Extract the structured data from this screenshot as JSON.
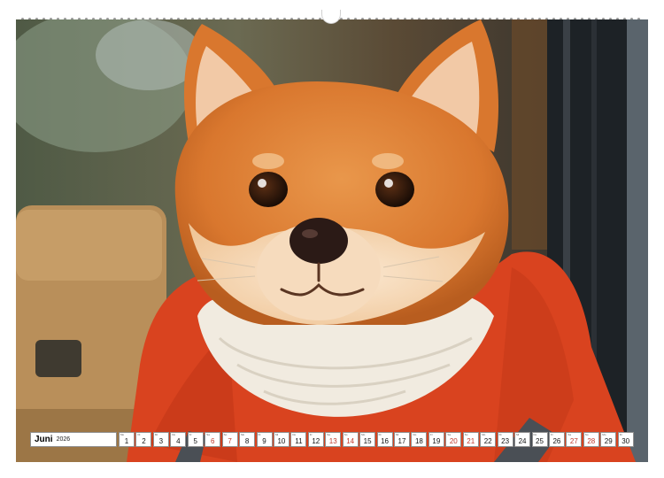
{
  "calendar": {
    "month": "Juni",
    "year": "2026",
    "weekend_color": "#c0392b",
    "days": [
      {
        "num": "1",
        "abbr": "Mo",
        "weekend": false
      },
      {
        "num": "2",
        "abbr": "Di",
        "weekend": false
      },
      {
        "num": "3",
        "abbr": "Mi",
        "weekend": false
      },
      {
        "num": "4",
        "abbr": "Do",
        "weekend": false
      },
      {
        "num": "5",
        "abbr": "Fr",
        "weekend": false
      },
      {
        "num": "6",
        "abbr": "Sa",
        "weekend": true
      },
      {
        "num": "7",
        "abbr": "So",
        "weekend": true
      },
      {
        "num": "8",
        "abbr": "Mo",
        "weekend": false
      },
      {
        "num": "9",
        "abbr": "Di",
        "weekend": false
      },
      {
        "num": "10",
        "abbr": "Mi",
        "weekend": false
      },
      {
        "num": "11",
        "abbr": "Do",
        "weekend": false
      },
      {
        "num": "12",
        "abbr": "Fr",
        "weekend": false
      },
      {
        "num": "13",
        "abbr": "Sa",
        "weekend": true
      },
      {
        "num": "14",
        "abbr": "So",
        "weekend": true
      },
      {
        "num": "15",
        "abbr": "Mo",
        "weekend": false
      },
      {
        "num": "16",
        "abbr": "Di",
        "weekend": false
      },
      {
        "num": "17",
        "abbr": "Mi",
        "weekend": false
      },
      {
        "num": "18",
        "abbr": "Do",
        "weekend": false
      },
      {
        "num": "19",
        "abbr": "Fr",
        "weekend": false
      },
      {
        "num": "20",
        "abbr": "Sa",
        "weekend": true
      },
      {
        "num": "21",
        "abbr": "So",
        "weekend": true
      },
      {
        "num": "22",
        "abbr": "Mo",
        "weekend": false
      },
      {
        "num": "23",
        "abbr": "Di",
        "weekend": false
      },
      {
        "num": "24",
        "abbr": "Mi",
        "weekend": false
      },
      {
        "num": "25",
        "abbr": "Do",
        "weekend": false
      },
      {
        "num": "26",
        "abbr": "Fr",
        "weekend": false
      },
      {
        "num": "27",
        "abbr": "Sa",
        "weekend": true
      },
      {
        "num": "28",
        "abbr": "So",
        "weekend": true
      },
      {
        "num": "29",
        "abbr": "Mo",
        "weekend": false
      },
      {
        "num": "30",
        "abbr": "Di",
        "weekend": false
      }
    ]
  },
  "photo": {
    "subject": "shiba-inu-dog",
    "colors": {
      "fur": "#d9772e",
      "fur_light": "#f3d3ad",
      "coat": "#d9431f",
      "scarf": "#f1ebe0",
      "window_frame": "#1d2226",
      "interior": "#b98f5a"
    }
  }
}
